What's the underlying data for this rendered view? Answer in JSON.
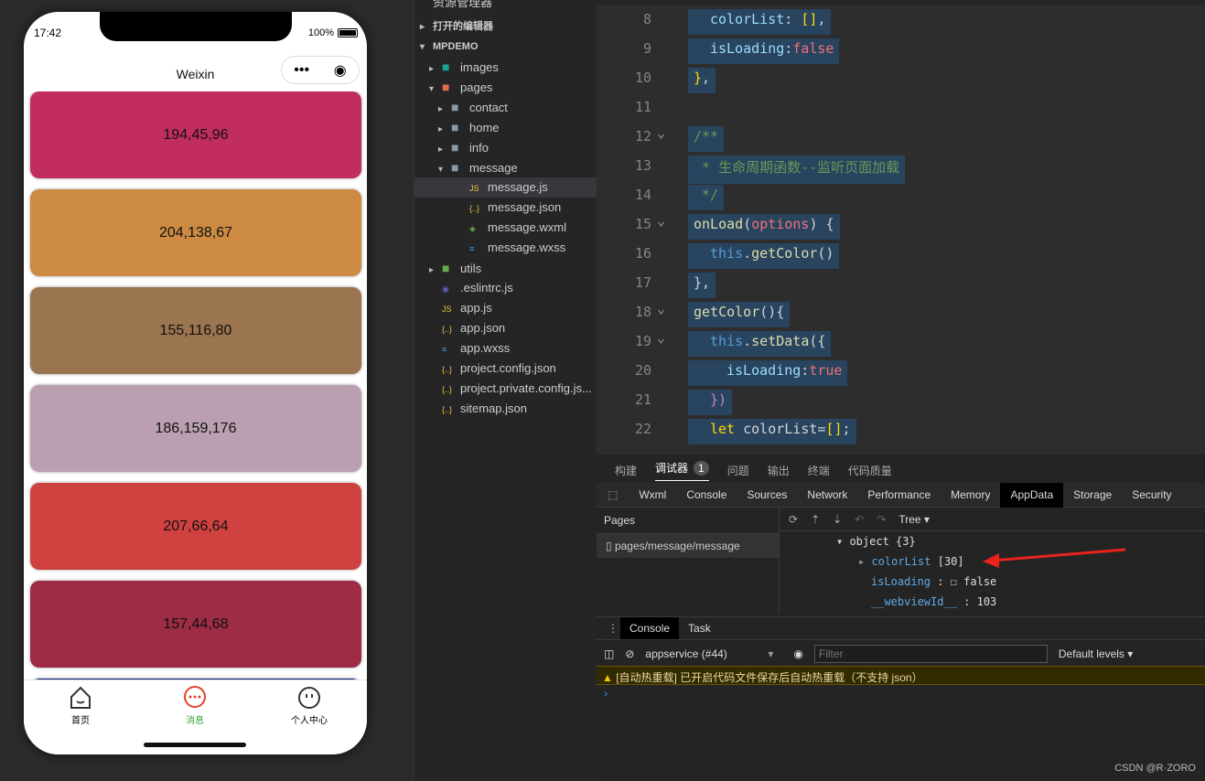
{
  "phone": {
    "time": "17:42",
    "battery": "100%",
    "title": "Weixin",
    "cards": [
      {
        "label": "194,45,96",
        "color": "#c22d60"
      },
      {
        "label": "204,138,67",
        "color": "#cc8a43"
      },
      {
        "label": "155,116,80",
        "color": "#9b7450"
      },
      {
        "label": "186,159,176",
        "color": "#ba9fb0"
      },
      {
        "label": "207,66,64",
        "color": "#cf4240"
      },
      {
        "label": "157,44,68",
        "color": "#9d2c44"
      },
      {
        "label": "",
        "color": "#0a1a7a"
      }
    ],
    "tabs": [
      {
        "label": "首页",
        "icon": "home-icon"
      },
      {
        "label": "消息",
        "icon": "message-icon",
        "active": true
      },
      {
        "label": "个人中心",
        "icon": "face-icon"
      }
    ],
    "active_color": "#e0422c",
    "active_label_color": "#3aa53a"
  },
  "explorer": {
    "header": "资源管理器",
    "items": [
      {
        "label": "打开的编辑器",
        "depth": 0,
        "arrow": "▸",
        "icon": ""
      },
      {
        "label": "MPDEMO",
        "depth": 0,
        "arrow": "▾",
        "icon": ""
      },
      {
        "label": "images",
        "depth": 1,
        "arrow": "▸",
        "icon": "folder-images-icon"
      },
      {
        "label": "pages",
        "depth": 1,
        "arrow": "▾",
        "icon": "folder-pages-icon"
      },
      {
        "label": "contact",
        "depth": 2,
        "arrow": "▸",
        "icon": "folder-icon"
      },
      {
        "label": "home",
        "depth": 2,
        "arrow": "▸",
        "icon": "folder-icon"
      },
      {
        "label": "info",
        "depth": 2,
        "arrow": "▸",
        "icon": "folder-icon"
      },
      {
        "label": "message",
        "depth": 2,
        "arrow": "▾",
        "icon": "folder-icon"
      },
      {
        "label": "message.js",
        "depth": 3,
        "arrow": "",
        "icon": "js-icon",
        "selected": true
      },
      {
        "label": "message.json",
        "depth": 3,
        "arrow": "",
        "icon": "json-icon"
      },
      {
        "label": "message.wxml",
        "depth": 3,
        "arrow": "",
        "icon": "wxml-icon"
      },
      {
        "label": "message.wxss",
        "depth": 3,
        "arrow": "",
        "icon": "css-icon"
      },
      {
        "label": "utils",
        "depth": 1,
        "arrow": "▸",
        "icon": "folder-utils-icon"
      },
      {
        "label": ".eslintrc.js",
        "depth": 1,
        "arrow": "",
        "icon": "eslint-icon"
      },
      {
        "label": "app.js",
        "depth": 1,
        "arrow": "",
        "icon": "js-icon"
      },
      {
        "label": "app.json",
        "depth": 1,
        "arrow": "",
        "icon": "json-icon"
      },
      {
        "label": "app.wxss",
        "depth": 1,
        "arrow": "",
        "icon": "css-icon"
      },
      {
        "label": "project.config.json",
        "depth": 1,
        "arrow": "",
        "icon": "json-icon"
      },
      {
        "label": "project.private.config.js...",
        "depth": 1,
        "arrow": "",
        "icon": "json-icon"
      },
      {
        "label": "sitemap.json",
        "depth": 1,
        "arrow": "",
        "icon": "json-icon"
      }
    ]
  },
  "editor": {
    "lines": [
      {
        "n": "8",
        "indent": 1,
        "tokens": [
          [
            "p",
            "colorList"
          ],
          [
            "t",
            ": "
          ],
          [
            "y",
            "[]"
          ],
          [
            "t",
            ","
          ]
        ]
      },
      {
        "n": "9",
        "indent": 1,
        "tokens": [
          [
            "p",
            "isLoading"
          ],
          [
            "t",
            ":"
          ],
          [
            "b",
            "false"
          ]
        ]
      },
      {
        "n": "10",
        "indent": 0,
        "tokens": [
          [
            "y",
            "}"
          ],
          [
            "t",
            ","
          ]
        ]
      },
      {
        "n": "11",
        "indent": 0,
        "tokens": []
      },
      {
        "n": "12",
        "indent": 0,
        "tokens": [
          [
            "c",
            "/**"
          ]
        ]
      },
      {
        "n": "13",
        "indent": 0,
        "tokens": [
          [
            "c",
            " * 生命周期函数--监听页面加载"
          ]
        ]
      },
      {
        "n": "14",
        "indent": 0,
        "tokens": [
          [
            "c",
            " */"
          ]
        ]
      },
      {
        "n": "15",
        "indent": 0,
        "tokens": [
          [
            "f",
            "onLoad"
          ],
          [
            "t",
            "("
          ],
          [
            "b",
            "options"
          ],
          [
            "t",
            ") {"
          ]
        ]
      },
      {
        "n": "16",
        "indent": 1,
        "tokens": [
          [
            "kw",
            "this"
          ],
          [
            "t",
            "."
          ],
          [
            "f",
            "getColor"
          ],
          [
            "t",
            "()"
          ]
        ]
      },
      {
        "n": "17",
        "indent": 0,
        "tokens": [
          [
            "t",
            "},"
          ]
        ]
      },
      {
        "n": "18",
        "indent": 0,
        "tokens": [
          [
            "f",
            "getColor"
          ],
          [
            "t",
            "(){"
          ]
        ]
      },
      {
        "n": "19",
        "indent": 1,
        "tokens": [
          [
            "kw",
            "this"
          ],
          [
            "t",
            "."
          ],
          [
            "f",
            "setData"
          ],
          [
            "t",
            "({"
          ]
        ]
      },
      {
        "n": "20",
        "indent": 2,
        "tokens": [
          [
            "p",
            "isLoading"
          ],
          [
            "t",
            ":"
          ],
          [
            "b",
            "true"
          ]
        ]
      },
      {
        "n": "21",
        "indent": 1,
        "tokens": [
          [
            "k",
            "})"
          ]
        ]
      },
      {
        "n": "22",
        "indent": 1,
        "tokens": [
          [
            "y",
            "let "
          ],
          [
            "t",
            "colorList="
          ],
          [
            "y",
            "[]"
          ],
          [
            "t",
            ";"
          ]
        ]
      }
    ]
  },
  "devtools": {
    "top_tabs": [
      "构建",
      "调试器",
      "问题",
      "输出",
      "终端",
      "代码质量"
    ],
    "badge": "1",
    "sub_tabs": [
      "Wxml",
      "Console",
      "Sources",
      "Network",
      "Performance",
      "Memory",
      "AppData",
      "Storage",
      "Security"
    ],
    "active_sub": "AppData",
    "pages_label": "Pages",
    "page_item": "pages/message/message",
    "view_mode": "Tree",
    "tree": {
      "root": "object {3}",
      "colorList_key": "colorList",
      "colorList_val": "[30]",
      "isLoading_key": "isLoading",
      "isLoading_val": "false",
      "webview_key": "__webviewId__",
      "webview_val": "103"
    },
    "console_tabs": [
      "Console",
      "Task"
    ],
    "context": "appservice (#44)",
    "filter_placeholder": "Filter",
    "levels": "Default levels",
    "warning": "[自动热重载] 已开启代码文件保存后自动热重载（不支持 json）"
  },
  "watermark": "CSDN @R·ZORO"
}
